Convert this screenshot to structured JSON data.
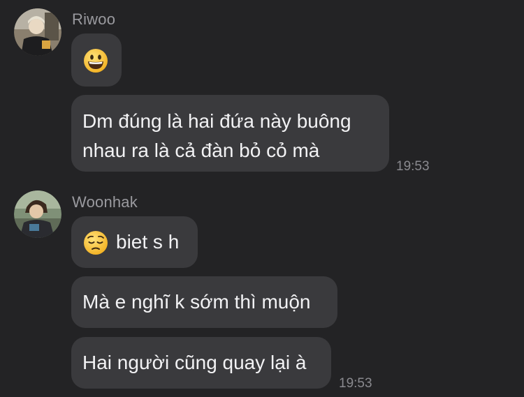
{
  "conversation": {
    "groups": [
      {
        "sender": "Riwoo",
        "avatar_icon": "riwoo-avatar",
        "messages": [
          {
            "emoji": "grinning-face-icon"
          },
          {
            "text_line1": "Dm đúng là hai đứa này buông",
            "text_line2": "nhau ra là cả đàn bỏ cỏ mà"
          }
        ],
        "timestamp": "19:53"
      },
      {
        "sender": "Woonhak",
        "avatar_icon": "woonhak-avatar",
        "messages": [
          {
            "emoji": "pensive-face-icon",
            "text": "biet s h"
          },
          {
            "text": "Mà e nghĩ k sớm thì muộn"
          },
          {
            "text": "Hai người cũng quay lại à"
          }
        ],
        "timestamp": "19:53"
      }
    ]
  },
  "colors": {
    "background": "#232325",
    "bubble": "#3a3a3d",
    "text": "#f2f2f4",
    "meta": "#9a9a9f",
    "emoji": "#f7c531"
  }
}
